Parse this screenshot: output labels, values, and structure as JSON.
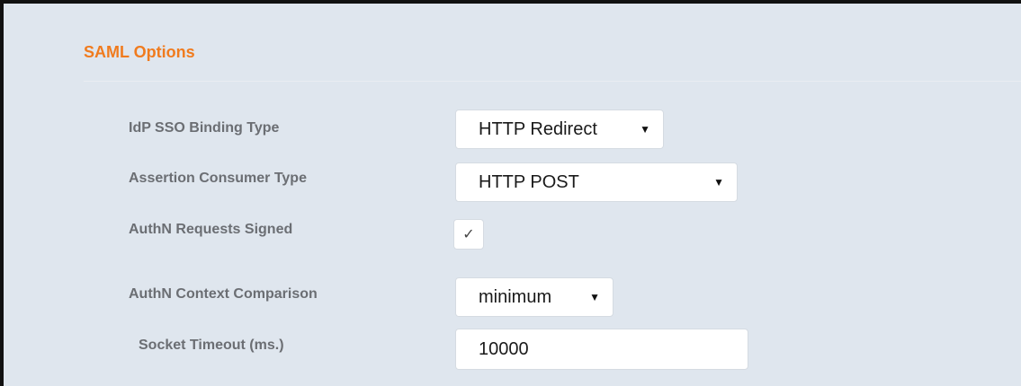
{
  "section": {
    "title": "SAML Options"
  },
  "fields": {
    "idp_sso_binding": {
      "label": "IdP SSO Binding Type",
      "value": "HTTP Redirect",
      "caret": "▼"
    },
    "assertion_consumer": {
      "label": "Assertion Consumer Type",
      "value": "HTTP POST",
      "caret": "▼"
    },
    "authn_requests_signed": {
      "label": "AuthN Requests Signed",
      "checked": true,
      "check_glyph": "✓"
    },
    "authn_context_comparison": {
      "label": "AuthN Context Comparison",
      "value": "minimum",
      "caret": "▼"
    },
    "socket_timeout": {
      "label": "Socket Timeout (ms.)",
      "value": "10000"
    }
  },
  "colors": {
    "accent": "#f07b1e",
    "panel_background": "#dfe6ee",
    "label_text": "#6b6e73"
  },
  "icons": {
    "dropdown": "chevron-down-icon",
    "check": "checkmark-icon"
  }
}
